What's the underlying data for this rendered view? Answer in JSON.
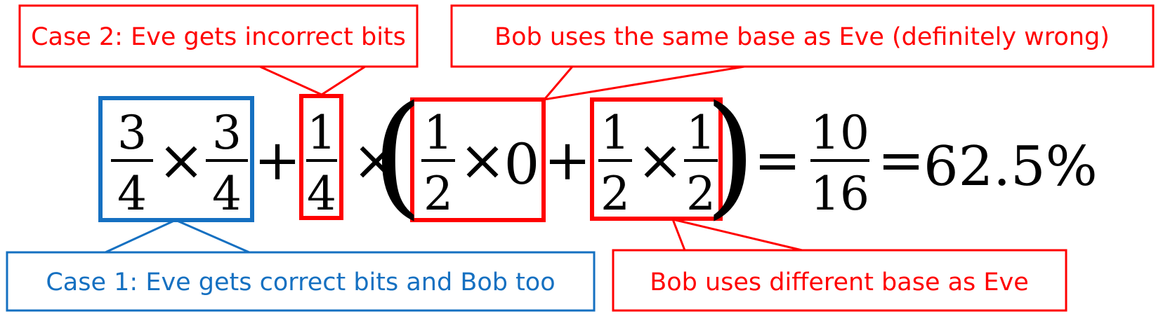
{
  "colors": {
    "red": "#ff0000",
    "blue": "#1570c1",
    "ink": "#000000"
  },
  "callouts": {
    "case2": "Case 2: Eve gets incorrect bits",
    "same_base": "Bob uses the same base as Eve (definitely wrong)",
    "case1": "Case 1: Eve gets correct bits and Bob too",
    "diff_base": "Bob uses different base as Eve"
  },
  "equation": {
    "t1_num": "3",
    "t1_den": "4",
    "times": "×",
    "t2_num": "3",
    "t2_den": "4",
    "plus": "+",
    "t3_num": "1",
    "t3_den": "4",
    "lparen": "(",
    "t4_num": "1",
    "t4_den": "2",
    "zero": "0",
    "t5_num": "1",
    "t5_den": "2",
    "t6_num": "1",
    "t6_den": "2",
    "rparen": ")",
    "equals": "=",
    "res_num": "10",
    "res_den": "16",
    "percent": "62.5%"
  }
}
